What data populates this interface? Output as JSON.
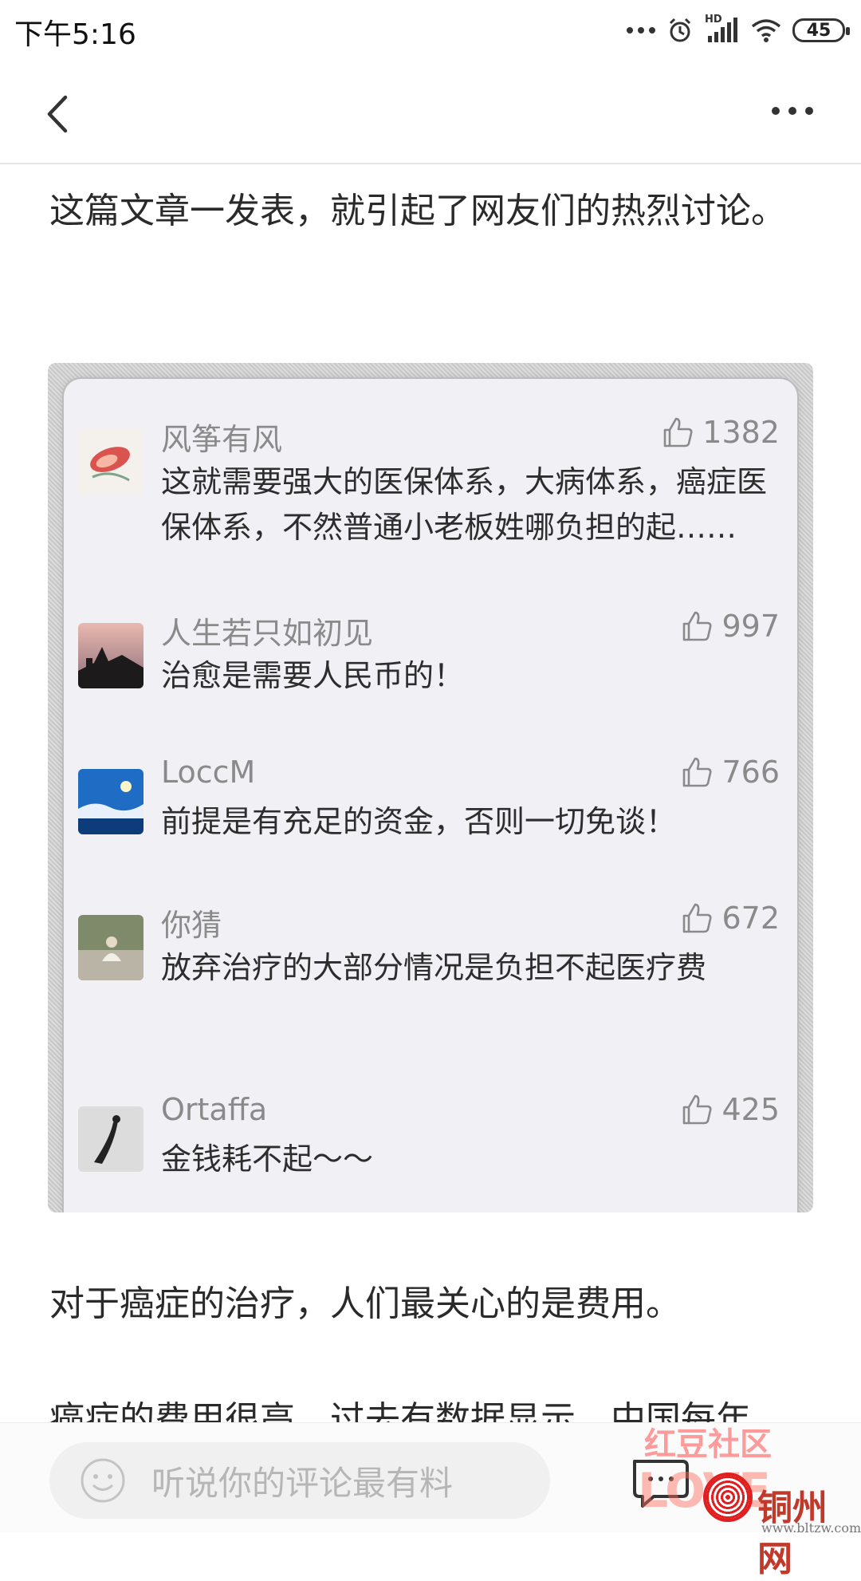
{
  "status_bar": {
    "time": "下午5:16",
    "network": "HD",
    "battery": "45",
    "icons": [
      "more-dots-icon",
      "alarm-icon",
      "signal-icon",
      "wifi-icon",
      "battery-icon"
    ]
  },
  "header": {
    "back_icon": "chevron-left-icon",
    "more_icon": "more-horizontal-icon"
  },
  "article": {
    "p1": "这篇文章一发表，就引起了网友们的热烈讨论。",
    "p2": "对于癌症的治疗，人们最关心的是费用。",
    "p3": "癌症的费用很高，过去有数据显示，中国每年"
  },
  "comments": [
    {
      "name": "风筝有风",
      "likes": "1382",
      "text": "这就需要强大的医保体系，大病体系，癌症医保体系，不然普通小老板姓哪负担的起……"
    },
    {
      "name": "人生若只如初见",
      "likes": "997",
      "text": "治愈是需要人民币的！"
    },
    {
      "name": "LoccM",
      "likes": "766",
      "text": "前提是有充足的资金，否则一切免谈！"
    },
    {
      "name": "你猜",
      "likes": "672",
      "text": "放弃治疗的大部分情况是负担不起医疗费"
    },
    {
      "name": "Ortaffa",
      "likes": "425",
      "text": "金钱耗不起～～"
    }
  ],
  "bottom_bar": {
    "comment_placeholder": "听说你的评论最有料",
    "emoji_icon": "smile-icon",
    "comment_icon": "comment-bubble-icon"
  },
  "watermark": {
    "top": "红豆社区",
    "love": "LOVE",
    "site": "铜州网",
    "url": "www.bltzw.com"
  },
  "colors": {
    "text": "#2a2a2a",
    "muted": "#8a8a8a",
    "card_bg": "#f1f0f4",
    "watermark_red": "#e02020"
  }
}
